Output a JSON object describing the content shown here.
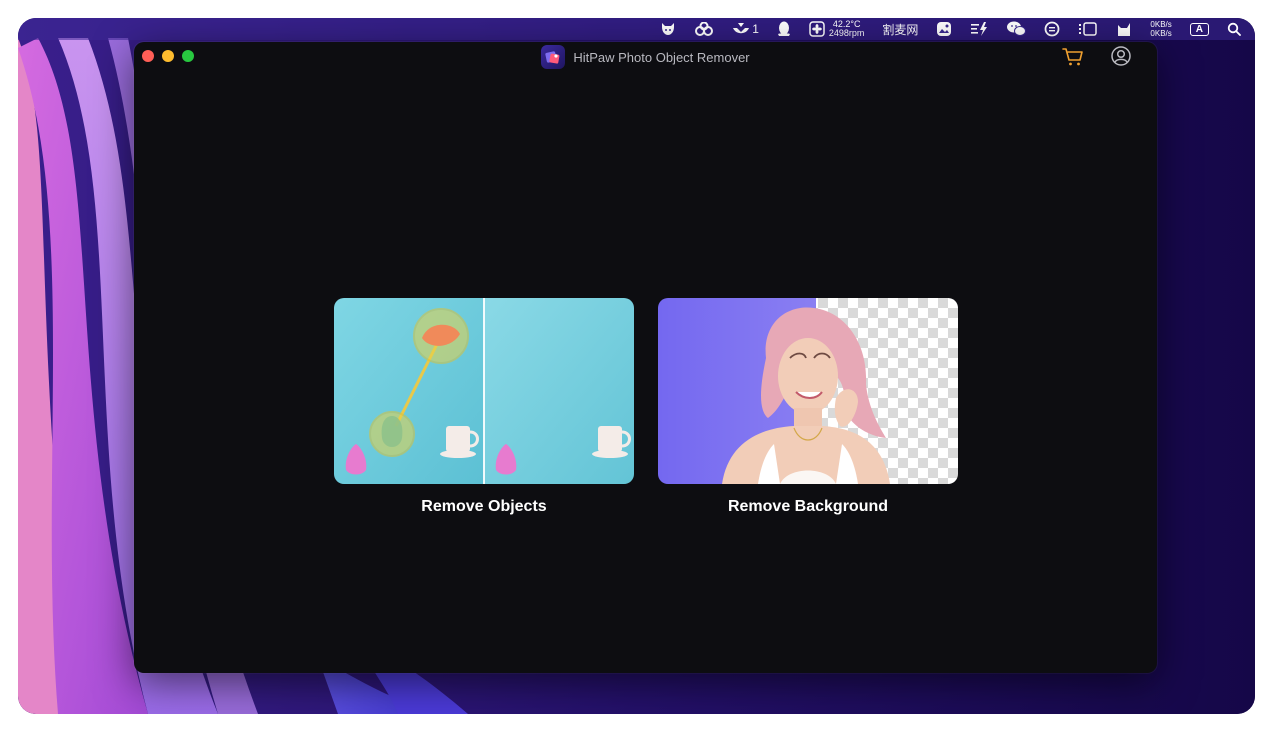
{
  "menubar": {
    "badge_count": "1",
    "cpu_temp": "42.2°C",
    "fan_speed": "2498rpm",
    "app_label": "割麦网",
    "net_up": "0KB/s",
    "net_down": "0KB/s",
    "input_source": "A"
  },
  "window": {
    "title": "HitPaw Photo Object Remover"
  },
  "features": [
    {
      "label": "Remove Objects"
    },
    {
      "label": "Remove Background"
    }
  ],
  "colors": {
    "window_bg": "#0d0d11",
    "cart_accent": "#f0a030",
    "menubar_text": "#ffffff"
  }
}
